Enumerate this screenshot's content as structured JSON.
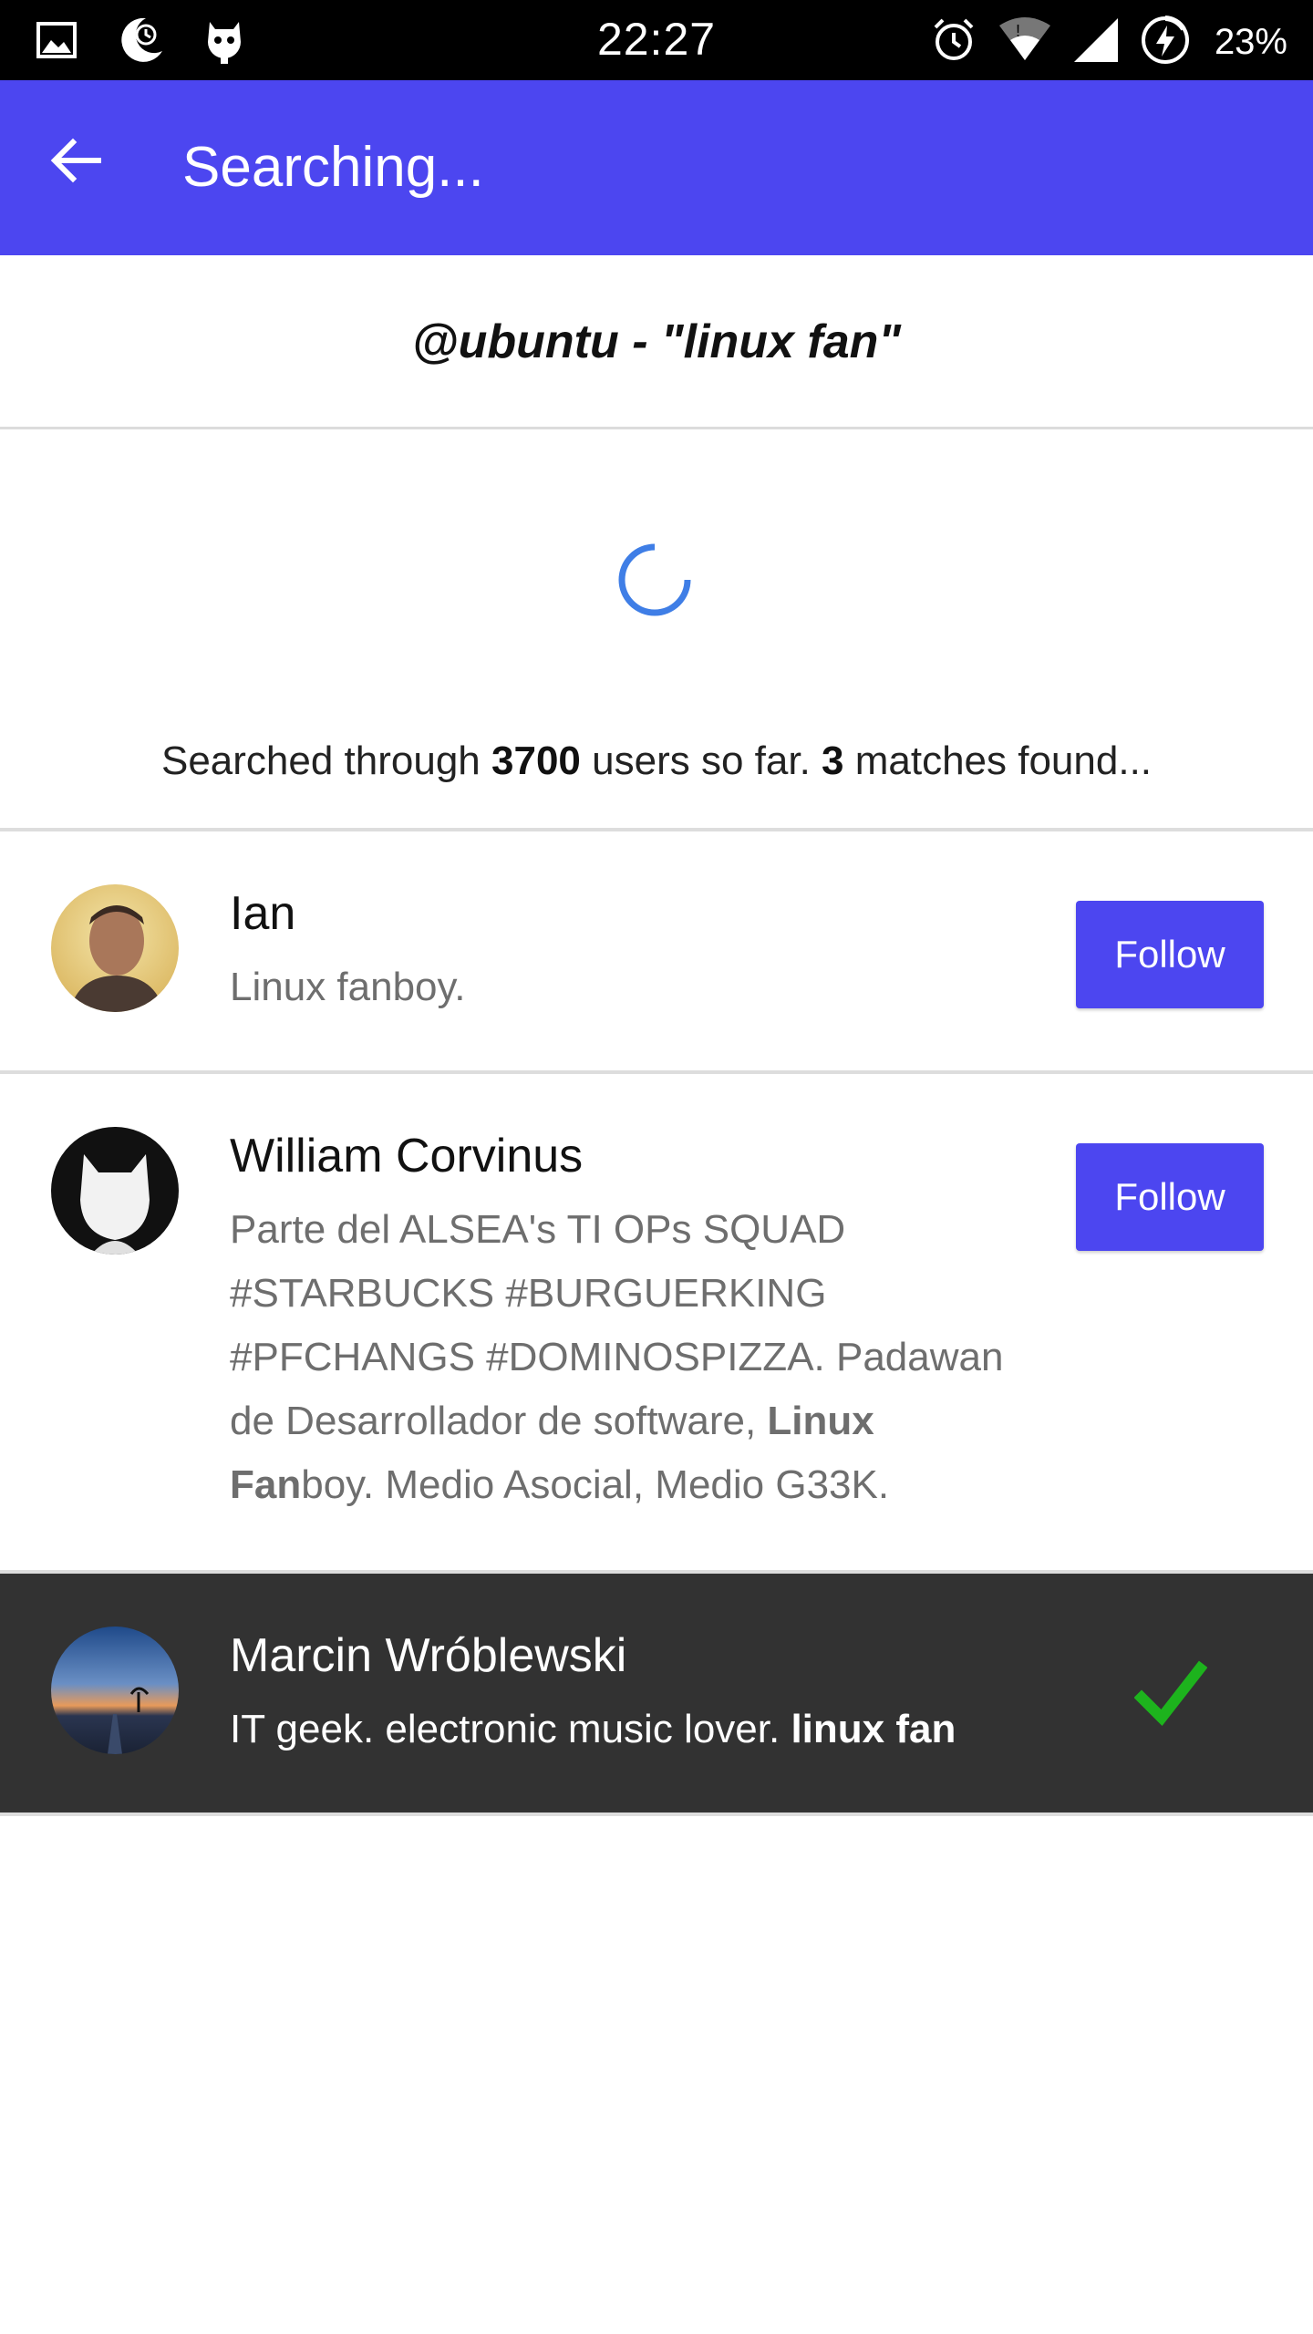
{
  "status_bar": {
    "time": "22:27",
    "battery": "23%",
    "left_icons": [
      "image-icon",
      "moon-clock-icon",
      "cyanogen-mod-icon"
    ],
    "right_icons": [
      "alarm-icon",
      "wifi-icon",
      "signal-icon",
      "battery-charging-icon"
    ]
  },
  "app_bar": {
    "title": "Searching...",
    "back_icon": "arrow-back-icon",
    "color": "#4c46f0"
  },
  "query": "@ubuntu - \"linux fan\"",
  "progress": {
    "prefix": "Searched through ",
    "count": "3700",
    "middle": " users so far. ",
    "matches": "3",
    "suffix": " matches found..."
  },
  "users": [
    {
      "name": "Ian",
      "bio": "Linux fanboy.",
      "follow_label": "Follow"
    },
    {
      "name": "William Corvinus",
      "bio_line1": "Parte del ALSEA's TI OPs SQUAD",
      "bio_line2": "#STARBUCKS #BURGUERKING",
      "bio_line3": "#PFCHANGS #DOMINOSPIZZA. Padawan",
      "bio_line4_pre": "de Desarrollador de software, ",
      "bio_line4_bold": "Linux",
      "bio_line5_bold": "Fan",
      "bio_line5_post": "boy. Medio Asocial, Medio G33K.",
      "follow_label": "Follow"
    },
    {
      "name": "Marcin Wróblewski",
      "bio_pre": "IT geek. electronic music lover. ",
      "bio_bold": "linux fan",
      "status_icon": "checkmark-icon",
      "status_color": "#1db31d"
    }
  ]
}
